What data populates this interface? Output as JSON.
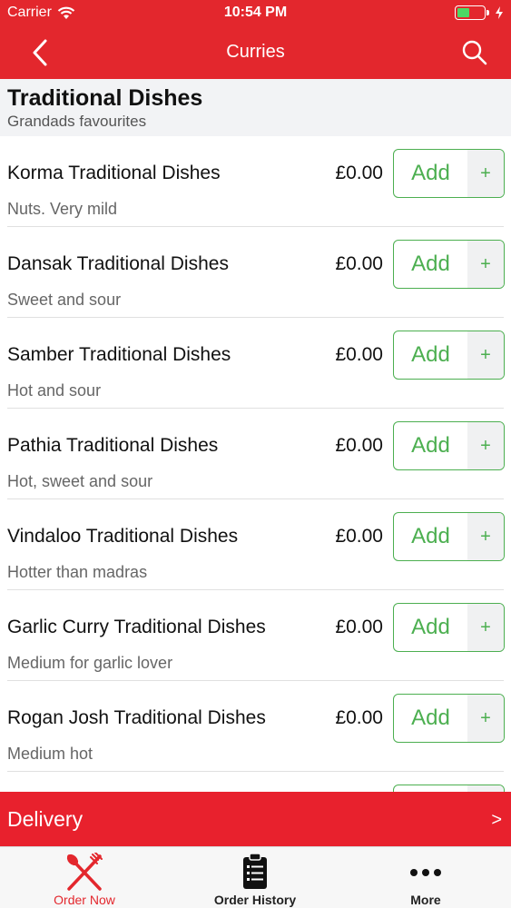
{
  "status_bar": {
    "carrier": "Carrier",
    "time": "10:54 PM"
  },
  "nav": {
    "title": "Curries",
    "back_icon": "chevron-left-icon",
    "search_icon": "search-icon"
  },
  "section": {
    "title": "Traditional Dishes",
    "subtitle": "Grandads favourites"
  },
  "items": [
    {
      "name": "Korma Traditional Dishes",
      "price": "£0.00",
      "description": "Nuts. Very mild",
      "add_label": "Add",
      "plus": "+"
    },
    {
      "name": "Dansak Traditional Dishes",
      "price": "£0.00",
      "description": "Sweet and sour",
      "add_label": "Add",
      "plus": "+"
    },
    {
      "name": "Samber Traditional Dishes",
      "price": "£0.00",
      "description": "Hot and sour",
      "add_label": "Add",
      "plus": "+"
    },
    {
      "name": "Pathia Traditional Dishes",
      "price": "£0.00",
      "description": "Hot, sweet and sour",
      "add_label": "Add",
      "plus": "+"
    },
    {
      "name": "Vindaloo Traditional Dishes",
      "price": "£0.00",
      "description": "Hotter than madras",
      "add_label": "Add",
      "plus": "+"
    },
    {
      "name": "Garlic Curry Traditional Dishes",
      "price": "£0.00",
      "description": "Medium for garlic lover",
      "add_label": "Add",
      "plus": "+"
    },
    {
      "name": "Rogan Josh Traditional Dishes",
      "price": "£0.00",
      "description": "Medium hot",
      "add_label": "Add",
      "plus": "+"
    },
    {
      "name": "",
      "price": "",
      "description": "",
      "add_label": "",
      "plus": ""
    }
  ],
  "delivery": {
    "label": "Delivery",
    "chevron": ">"
  },
  "tabs": [
    {
      "label": "Order Now",
      "icon": "fork-knife-icon",
      "active": true
    },
    {
      "label": "Order History",
      "icon": "clipboard-list-icon",
      "active": false
    },
    {
      "label": "More",
      "icon": "more-dots-icon",
      "active": false
    }
  ],
  "colors": {
    "brand_red": "#e3272d",
    "delivery_red": "#e8212d",
    "add_green": "#4caf50",
    "battery_green": "#4cd964"
  }
}
